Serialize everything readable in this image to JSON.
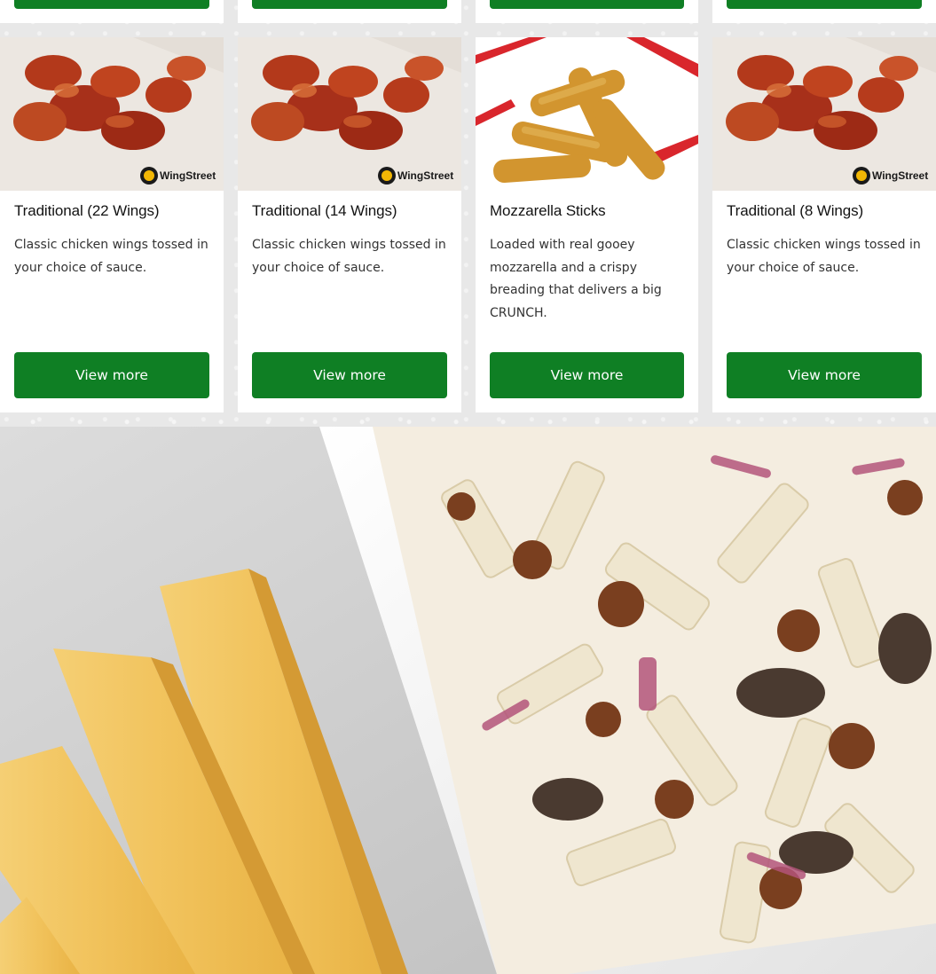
{
  "top_partial_cards": [
    {
      "button_label": ""
    },
    {
      "button_label": ""
    },
    {
      "button_label": ""
    },
    {
      "button_label": ""
    }
  ],
  "products": [
    {
      "title": "Traditional (22 Wings)",
      "description": "Classic chicken wings tossed in your choice of sauce.",
      "button_label": "View more",
      "image": "wings-photo",
      "brand_badge": "WingStreet"
    },
    {
      "title": "Traditional (14 Wings)",
      "description": "Classic chicken wings tossed in your choice of sauce.",
      "button_label": "View more",
      "image": "wings-photo",
      "brand_badge": "WingStreet"
    },
    {
      "title": "Mozzarella Sticks",
      "description": "Loaded with real gooey mozzarella and a crispy breading that delivers a big CRUNCH.",
      "button_label": "View more",
      "image": "mozzarella-sticks-photo",
      "brand_badge": ""
    },
    {
      "title": "Traditional (8 Wings)",
      "description": "Classic chicken wings tossed in your choice of sauce.",
      "button_label": "View more",
      "image": "wings-photo",
      "brand_badge": "WingStreet"
    }
  ],
  "hero": {
    "image": "pasta-and-breadsticks-photo"
  },
  "colors": {
    "button_green": "#0f7f24",
    "card_bg": "#ffffff",
    "page_bg": "#e8e8e8",
    "title_text": "#131313",
    "body_text": "#333333"
  }
}
